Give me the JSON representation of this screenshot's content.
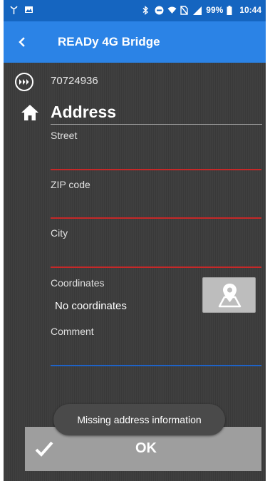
{
  "status_bar": {
    "battery_percent": "99%",
    "time": "10:44",
    "left_icons": [
      "signal-antenna-icon",
      "gallery-icon"
    ],
    "right_icons": [
      "bluetooth-icon",
      "do-not-disturb-icon",
      "wifi-icon",
      "no-sim-icon",
      "cell-signal-icon",
      "battery-icon"
    ]
  },
  "app_bar": {
    "title": "READy 4G Bridge",
    "back_icon": "chevron-left-icon"
  },
  "device": {
    "id": "70724936",
    "icon": "forward-dots-circle-icon"
  },
  "section": {
    "title": "Address",
    "icon": "home-icon"
  },
  "form": {
    "street_label": "Street",
    "street_value": "",
    "zip_label": "ZIP code",
    "zip_value": "",
    "city_label": "City",
    "city_value": "",
    "coordinates_label": "Coordinates",
    "coordinates_value": "No coordinates",
    "comment_label": "Comment",
    "comment_value": "",
    "map_button_icon": "map-pin-icon"
  },
  "ok_button": {
    "label": "OK",
    "icon": "checkmark-icon"
  },
  "toast": {
    "message": "Missing address information"
  },
  "colors": {
    "status_bar": "#1565c0",
    "app_bar": "#2b83e6",
    "background": "#3f3f3f",
    "error_underline": "#c62828",
    "focus_underline": "#1e63c8",
    "button": "#9e9e9e"
  }
}
